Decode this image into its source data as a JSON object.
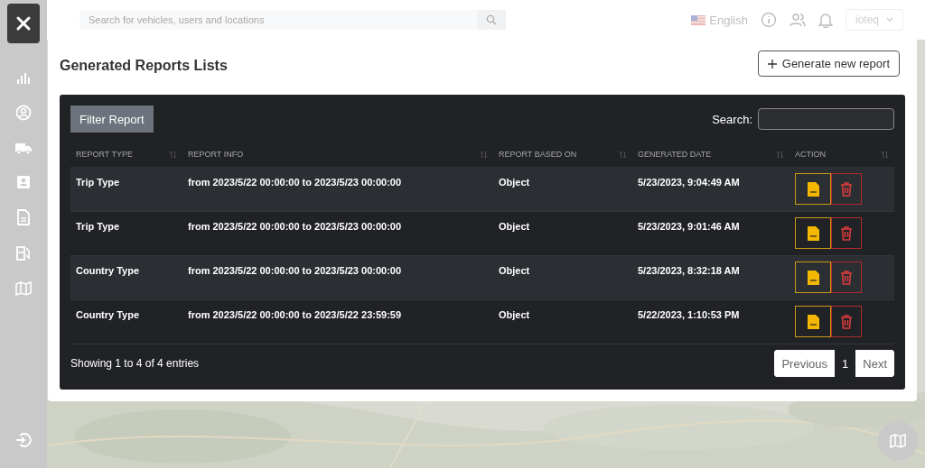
{
  "top_bar": {
    "search": {
      "placeholder": "Search for vehicles, users and locations"
    },
    "language": "English",
    "user": "ioteq"
  },
  "page": {
    "title": "Generated Reports Lists",
    "generate_button": "Generate new report"
  },
  "table": {
    "filter_button": "Filter Report",
    "search_label": "Search:",
    "columns": [
      "REPORT TYPE",
      "REPORT INFO",
      "REPORT BASED ON",
      "GENERATED DATE",
      "ACTION"
    ],
    "rows": [
      {
        "cells": [
          "Trip Type",
          "from 2023/5/22 00:00:00 to 2023/5/23 00:00:00",
          "Object",
          "5/23/2023, 9:04:49 AM"
        ]
      },
      {
        "cells": [
          "Trip Type",
          "from 2023/5/22 00:00:00 to 2023/5/23 00:00:00",
          "Object",
          "5/23/2023, 9:01:46 AM"
        ]
      },
      {
        "cells": [
          "Country Type",
          "from 2023/5/22 00:00:00 to 2023/5/23 00:00:00",
          "Object",
          "5/23/2023, 8:32:18 AM"
        ]
      },
      {
        "cells": [
          "Country Type",
          "from 2023/5/22 00:00:00 to 2023/5/22 23:59:59",
          "Object",
          "5/22/2023, 1:10:53 PM"
        ]
      }
    ],
    "info": "Showing 1 to 4 of 4 entries",
    "pagination": [
      {
        "label": "Previous",
        "selected": false
      },
      {
        "label": "1",
        "selected": true
      },
      {
        "label": "Next",
        "selected": false
      }
    ]
  }
}
